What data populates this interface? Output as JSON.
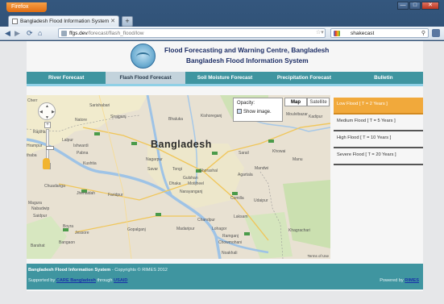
{
  "browser": {
    "app_button": "Firefox",
    "tab_title": "Bangladesh Flood Information System",
    "new_tab": "+",
    "url_host": "ffgs.dev",
    "url_path": "/forecast/flash_flood/low",
    "search_text": "shakecast"
  },
  "site": {
    "title_line1": "Flood Forecasting and Warning Centre, Bangladesh",
    "title_line2": "Bangladesh Flood Information System"
  },
  "menu": {
    "items": [
      {
        "label": "River Forecast"
      },
      {
        "label": "Flash Flood Forecast"
      },
      {
        "label": "Soil Moisture Forecast"
      },
      {
        "label": "Precipitation Forecast"
      },
      {
        "label": "Bulletin"
      }
    ],
    "active": "Flash Flood Forecast"
  },
  "map": {
    "country_label": "Bangladesh",
    "opacity_label": "Opacity:",
    "show_image_label": "Show image.",
    "map_button": "Map",
    "satellite_button": "Satellite",
    "terms": "Terms of Use",
    "places": [
      {
        "name": "Cherr",
        "cls": "l1"
      },
      {
        "name": "Sarishabari",
        "cls": "l2"
      },
      {
        "name": "Sirajganj",
        "cls": "l3"
      },
      {
        "name": "Bhaluka",
        "cls": "l4"
      },
      {
        "name": "Kishoreganj",
        "cls": "l5"
      },
      {
        "name": "Moulvibazar",
        "cls": "l6"
      },
      {
        "name": "Kadipur",
        "cls": "l7"
      },
      {
        "name": "Natore",
        "cls": "l8"
      },
      {
        "name": "Rajshahi",
        "cls": "l9"
      },
      {
        "name": "Lalpur",
        "cls": "l10"
      },
      {
        "name": "Ishwardi",
        "cls": "l11"
      },
      {
        "name": "Pabna",
        "cls": "l12"
      },
      {
        "name": "Kushtia",
        "cls": "l13"
      },
      {
        "name": "Hrampur",
        "cls": "l14"
      },
      {
        "name": "thaba",
        "cls": "l15"
      },
      {
        "name": "Nagarpur",
        "cls": "l16"
      },
      {
        "name": "Savar",
        "cls": "l17"
      },
      {
        "name": "Tongi",
        "cls": "l18"
      },
      {
        "name": "Ghorashal",
        "cls": "l19"
      },
      {
        "name": "Sarail",
        "cls": "l20"
      },
      {
        "name": "Khowai",
        "cls": "l21"
      },
      {
        "name": "Manu",
        "cls": "l22"
      },
      {
        "name": "Mandwi",
        "cls": "l23"
      },
      {
        "name": "Gulshan",
        "cls": "l24"
      },
      {
        "name": "Dhaka",
        "cls": "l25"
      },
      {
        "name": "Motijheel",
        "cls": "l26"
      },
      {
        "name": "Narayanganj",
        "cls": "l27"
      },
      {
        "name": "Agartala",
        "cls": "l28"
      },
      {
        "name": "Chuadanga",
        "cls": "l29"
      },
      {
        "name": "Jhenaidah",
        "cls": "l30"
      },
      {
        "name": "Faridpur",
        "cls": "l31"
      },
      {
        "name": "Magura",
        "cls": "l32"
      },
      {
        "name": "Comilla",
        "cls": "l33"
      },
      {
        "name": "Udaipur",
        "cls": "l34"
      },
      {
        "name": "Chandpur",
        "cls": "l35"
      },
      {
        "name": "Laksam",
        "cls": "l36"
      },
      {
        "name": "Saidpur",
        "cls": "l37"
      },
      {
        "name": "Boyra",
        "cls": "l38"
      },
      {
        "name": "Jessore",
        "cls": "l39"
      },
      {
        "name": "Bangaon",
        "cls": "l40"
      },
      {
        "name": "Barahat",
        "cls": "l41"
      },
      {
        "name": "Gopalganj",
        "cls": "l42"
      },
      {
        "name": "Madaripur",
        "cls": "l43"
      },
      {
        "name": "Lohagor",
        "cls": "l44"
      },
      {
        "name": "Ramganj",
        "cls": "l45"
      },
      {
        "name": "Khagrachari",
        "cls": "l46"
      },
      {
        "name": "Chowmohani",
        "cls": "l47"
      },
      {
        "name": "Noakhali",
        "cls": "l48"
      },
      {
        "name": "Nabadwip",
        "cls": "l49"
      }
    ]
  },
  "legend": {
    "items": [
      {
        "label": "Low Flood [ T = 2 Years ]",
        "active": true
      },
      {
        "label": "Medium Flood [ T = 5 Years ]",
        "active": false
      },
      {
        "label": "High Flood [ T = 10 Years ]",
        "active": false
      },
      {
        "label": "Severe Flood [ T = 20 Years ]",
        "active": false
      }
    ]
  },
  "footer": {
    "system_name": "Bangladesh Flood Information System",
    "copyright": " - Copyrights © RIMES 2012",
    "supported_by": "Supported by ",
    "care_link": "CARE Bangladesh",
    "through": " through ",
    "usaid_link": "USAID",
    "powered_by": "Powered by ",
    "rimes_link": "RIMES"
  },
  "colors": {
    "menu_bg": "#3f95a0",
    "legend_active": "#f1a93b",
    "title_text": "#1d2e66"
  }
}
